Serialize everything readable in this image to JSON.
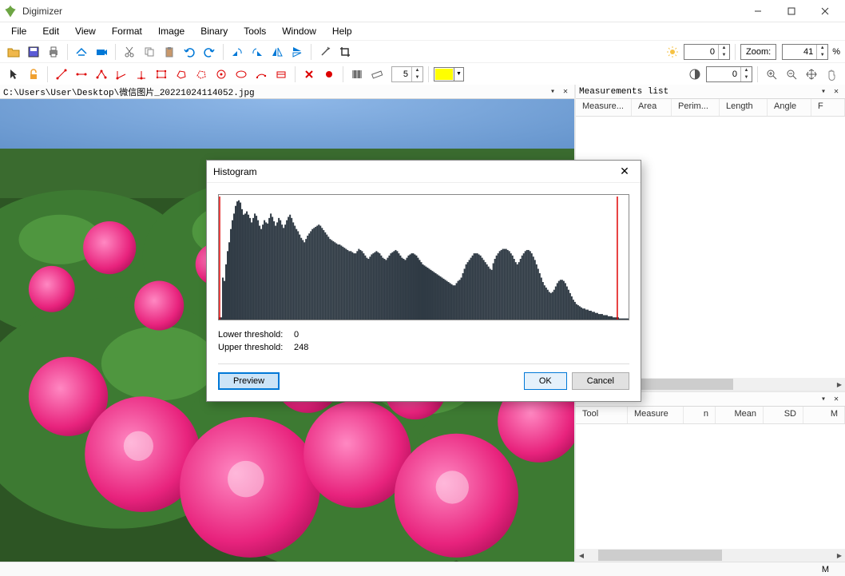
{
  "titlebar": {
    "title": "Digimizer"
  },
  "menu": [
    "File",
    "Edit",
    "View",
    "Format",
    "Image",
    "Binary",
    "Tools",
    "Window",
    "Help"
  ],
  "toolbar1": {
    "brightness_value": "0",
    "zoom_label": "Zoom:",
    "zoom_value": "41",
    "zoom_unit": "%"
  },
  "toolbar2": {
    "contrast_value": "0",
    "spinner_value": "5"
  },
  "image_panel": {
    "path": "C:\\Users\\User\\Desktop\\微信图片_20221024114052.jpg"
  },
  "measurements": {
    "title": "Measurements list",
    "columns": [
      "Measure...",
      "Area",
      "Perim...",
      "Length",
      "Angle",
      "F"
    ]
  },
  "stats": {
    "columns": [
      "Tool",
      "Measure",
      "n",
      "Mean",
      "SD",
      "M"
    ]
  },
  "statusbar": {
    "mode": "M"
  },
  "dialog": {
    "title": "Histogram",
    "lower_label": "Lower threshold:",
    "lower_value": "0",
    "upper_label": "Upper threshold:",
    "upper_value": "248",
    "preview": "Preview",
    "ok": "OK",
    "cancel": "Cancel",
    "chart_data": {
      "type": "bar",
      "categories_range": [
        0,
        255
      ],
      "values": [
        2,
        2,
        38,
        35,
        50,
        62,
        70,
        82,
        90,
        96,
        103,
        107,
        108,
        106,
        100,
        95,
        96,
        98,
        95,
        92,
        88,
        92,
        96,
        94,
        90,
        85,
        82,
        86,
        90,
        88,
        87,
        92,
        96,
        93,
        89,
        85,
        88,
        92,
        90,
        86,
        83,
        86,
        90,
        93,
        95,
        92,
        88,
        85,
        82,
        80,
        77,
        74,
        72,
        70,
        73,
        76,
        78,
        80,
        82,
        83,
        84,
        85,
        86,
        85,
        83,
        81,
        79,
        77,
        75,
        73,
        72,
        71,
        70,
        69,
        68,
        68,
        67,
        66,
        65,
        64,
        63,
        62,
        62,
        61,
        60,
        60,
        62,
        64,
        63,
        62,
        60,
        58,
        56,
        55,
        57,
        59,
        60,
        61,
        62,
        61,
        60,
        58,
        56,
        55,
        54,
        56,
        58,
        60,
        61,
        62,
        63,
        62,
        60,
        58,
        56,
        55,
        54,
        56,
        58,
        59,
        60,
        60,
        59,
        58,
        56,
        54,
        52,
        50,
        49,
        48,
        47,
        46,
        45,
        44,
        43,
        42,
        41,
        40,
        39,
        38,
        37,
        36,
        35,
        34,
        33,
        32,
        31,
        31,
        33,
        35,
        36,
        38,
        42,
        46,
        50,
        52,
        54,
        56,
        58,
        60,
        60,
        60,
        59,
        58,
        56,
        54,
        52,
        50,
        48,
        46,
        45,
        51,
        55,
        58,
        60,
        62,
        63,
        64,
        64,
        64,
        63,
        62,
        60,
        58,
        55,
        52,
        50,
        52,
        55,
        58,
        60,
        62,
        63,
        63,
        62,
        60,
        57,
        54,
        50,
        46,
        42,
        38,
        34,
        31,
        29,
        27,
        25,
        24,
        25,
        27,
        30,
        33,
        35,
        36,
        36,
        35,
        33,
        30,
        27,
        24,
        21,
        18,
        16,
        14,
        13,
        12,
        11,
        10,
        10,
        9,
        9,
        8,
        8,
        7,
        7,
        6,
        6,
        5,
        5,
        5,
        4,
        4,
        4,
        3,
        3,
        3,
        2,
        2,
        2,
        2,
        1,
        1,
        1,
        1,
        1,
        1
      ],
      "title": "Histogram",
      "xlabel": "",
      "ylabel": "",
      "ylim": [
        0,
        110
      ],
      "threshold_lines": [
        0,
        248
      ]
    }
  }
}
